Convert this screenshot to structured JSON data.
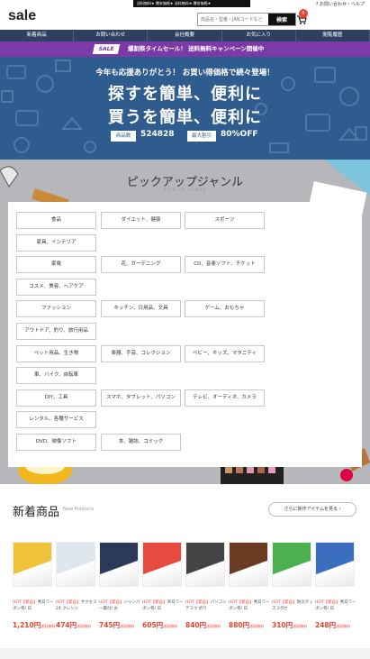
{
  "header": {
    "ticker": "送料無料★ 爆安価格★ 送料無料★ 爆安価格★",
    "help": "? お問い合わせ・ヘルプ",
    "logo": "sale",
    "search_placeholder": "商品名・型番・JANコードなど",
    "search_button": "検索",
    "cart_count": "0"
  },
  "nav": [
    "新着商品",
    "お問い合わせ",
    "会社概要",
    "お気に入り",
    "閲覧履歴"
  ],
  "promo": {
    "tag": "SALE",
    "text": "爆割祭タイムセール！ 送料無料キャンペーン開催中"
  },
  "hero": {
    "thanks": "今年も応援ありがとう！ お買い得価格で続々登場！",
    "line1": "探すを簡単、便利に",
    "line2": "買うを簡単、便利に",
    "count_label": "商品数",
    "count_value": "524828",
    "discount_label": "最大割引",
    "discount_value": "80%OFF"
  },
  "pickup": {
    "title": "ピックアップジャンル",
    "subtitle": "PICK UP GENRE",
    "genres": [
      [
        "食品",
        "ダイエット、健康",
        "スポーツ"
      ],
      [
        "家具、インテリア"
      ],
      [
        "家電",
        "花、ガーデニング",
        "CD、音楽ソフト、チケット"
      ],
      [
        "コスメ、美容、ヘアケア"
      ],
      [
        "ファッション",
        "キッチン、日用品、文具",
        "ゲーム、おもちゃ"
      ],
      [
        "アウトドア、釣り、旅行用品"
      ],
      [
        "ペット用品、生き物",
        "楽器、手芸、コレクション",
        "ベビー、キッズ、マタニティ"
      ],
      [
        "車、バイク、自転車"
      ],
      [
        "DIY、工具",
        "スマホ、タブレット、パソコン",
        "テレビ、オーディオ、カメラ"
      ],
      [
        "レンタル、各種サービス"
      ],
      [
        "DVD、映像ソフト",
        "本、雑誌、コミック"
      ]
    ]
  },
  "new_products": {
    "title": "新着商品",
    "subtitle": "New Products",
    "more": "さらに新作アイテムを見る ›",
    "items": [
      {
        "hot": "HOT【新品】",
        "name": "秀日ワーポン券/ 日",
        "price": "1,210円",
        "tax": "送料無料",
        "img_color": "#f0c23a"
      },
      {
        "hot": "HOT【新品】",
        "name": "サクセス24 クレンジ",
        "price": "474円",
        "tax": "送料無料",
        "img_color": "#dfe6ee"
      },
      {
        "hot": "HOT【新品】",
        "name": "ジャンパー裏付/ お",
        "price": "745円",
        "tax": "送料無料",
        "img_color": "#2c3a5a"
      },
      {
        "hot": "HOT【新品】",
        "name": "英日ワーポン券/ 日",
        "price": "605円",
        "tax": "送料無料",
        "img_color": "#e84a3f"
      },
      {
        "hot": "HOT【新品】",
        "name": "パソコンデスク 折り",
        "price": "840円",
        "tax": "送料無料",
        "img_color": "#444444"
      },
      {
        "hot": "HOT【新品】",
        "name": "秀日ワーポン券/ 日",
        "price": "880円",
        "tax": "送料無料",
        "img_color": "#6b3a22"
      },
      {
        "hot": "HOT【新品】",
        "name": "防災グッズ 2点セ",
        "price": "310円",
        "tax": "送料無料",
        "img_color": "#4caf50"
      },
      {
        "hot": "HOT【新品】",
        "name": "秀日ワーポン券/ 日",
        "price": "248円",
        "tax": "送料無料",
        "img_color": "#3a6fc0"
      }
    ]
  }
}
